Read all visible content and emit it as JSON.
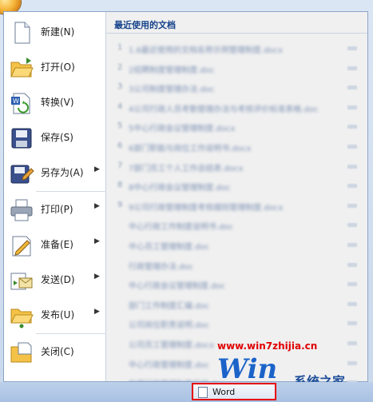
{
  "left_menu": {
    "items": [
      {
        "key": "new",
        "label": "新建(N)",
        "icon": "new-document-icon",
        "submenu": false
      },
      {
        "key": "open",
        "label": "打开(O)",
        "icon": "open-folder-icon",
        "submenu": false
      },
      {
        "key": "convert",
        "label": "转换(V)",
        "icon": "convert-icon",
        "submenu": false
      },
      {
        "key": "save",
        "label": "保存(S)",
        "icon": "save-disk-icon",
        "submenu": false
      },
      {
        "key": "saveas",
        "label": "另存为(A)",
        "icon": "save-as-icon",
        "submenu": true
      },
      {
        "key": "print",
        "label": "打印(P)",
        "icon": "printer-icon",
        "submenu": true
      },
      {
        "key": "prepare",
        "label": "准备(E)",
        "icon": "prepare-pencil-icon",
        "submenu": true
      },
      {
        "key": "send",
        "label": "发送(D)",
        "icon": "send-icon",
        "submenu": true
      },
      {
        "key": "publish",
        "label": "发布(U)",
        "icon": "publish-icon",
        "submenu": true
      },
      {
        "key": "close",
        "label": "关闭(C)",
        "icon": "close-folder-icon",
        "submenu": false
      }
    ],
    "arrow_glyph": "▶"
  },
  "recent": {
    "title": "最近使用的文档",
    "items": [
      {
        "num": "1",
        "name": "1.6最近使用的文档名称示例管理制度.docx"
      },
      {
        "num": "2",
        "name": "2招聘制度管理制度.doc"
      },
      {
        "num": "3",
        "name": "3公司制度管理办法.doc"
      },
      {
        "num": "4",
        "name": "4公司行政人员考勤管理办法与考核评价标准表格.doc"
      },
      {
        "num": "5",
        "name": "5中心行政会议管理制度.docx"
      },
      {
        "num": "6",
        "name": "6部门职能与岗位工作说明书.docx"
      },
      {
        "num": "7",
        "name": "7部门员工个人工作总结表.docx"
      },
      {
        "num": "8",
        "name": "8中心行政会议管理制度.doc"
      },
      {
        "num": "9",
        "name": "9公司行政管理制度考核细则管理制度.docx"
      },
      {
        "num": "",
        "name": "中心行政工作制度说明书.doc"
      },
      {
        "num": "",
        "name": "中心员工管理制度.doc"
      },
      {
        "num": "",
        "name": "行政管理办法.doc"
      },
      {
        "num": "",
        "name": "中心行政会议管理制度.doc"
      },
      {
        "num": "",
        "name": "部门工作制度汇编.doc"
      },
      {
        "num": "",
        "name": "公司岗位职责说明.doc"
      },
      {
        "num": "",
        "name": "公司员工管理制度.docx"
      },
      {
        "num": "",
        "name": "中心行政管理制度.doc"
      },
      {
        "num": "",
        "name": "年度行政管理制度汇编.doc"
      }
    ]
  },
  "watermark": {
    "url": "www.win7zhijia.cn",
    "logo_text": "Win",
    "brand": "系统之家"
  },
  "taskbar": {
    "button_label": "Word"
  },
  "colors": {
    "title_blue": "#15428b",
    "watermark_red": "#e00000",
    "highlight_border": "#e60000"
  }
}
